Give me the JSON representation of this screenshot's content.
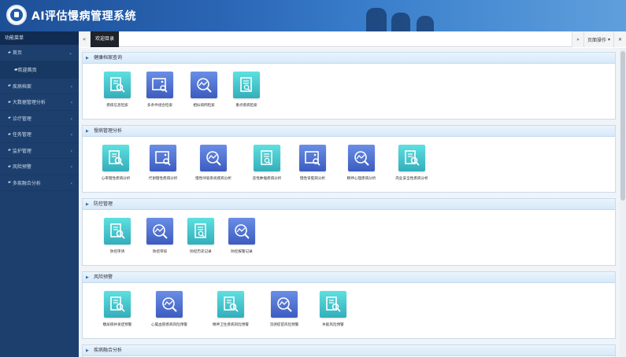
{
  "header": {
    "title": "AI评估慢病管理系统"
  },
  "sidebar": {
    "title": "功能菜单",
    "items": [
      {
        "label": "首页",
        "caret": "⌄"
      },
      {
        "label": "欢迎首页",
        "sub": true
      },
      {
        "label": "疾病档案",
        "caret": "‹"
      },
      {
        "label": "大数据管理分析",
        "caret": "‹"
      },
      {
        "label": "诊疗管理",
        "caret": "‹"
      },
      {
        "label": "任务管理",
        "caret": "‹"
      },
      {
        "label": "监护管理",
        "caret": "‹"
      },
      {
        "label": "风险预警",
        "caret": "‹"
      },
      {
        "label": "多疾融合分析",
        "caret": "‹"
      }
    ]
  },
  "tabbar": {
    "active_tab": "欢迎目录",
    "page_ops": "页面操作",
    "left_arrow": "«",
    "right_arrow": "»",
    "close": "✕"
  },
  "panels": [
    {
      "title": "健康档案查询",
      "tiles": [
        {
          "label": "疾病信息检索",
          "style": "teal",
          "icon": "document-search-icon"
        },
        {
          "label": "多条件组合检索",
          "style": "blue",
          "icon": "image-search-icon"
        },
        {
          "label": "相似病例检索",
          "style": "blue",
          "icon": "chart-search-icon"
        },
        {
          "label": "重点疾病检索",
          "style": "teal",
          "icon": "list-search-icon"
        }
      ]
    },
    {
      "title": "慢病管理分析",
      "tiles": [
        {
          "label": "心率慢性疾病分析",
          "style": "teal",
          "icon": "document-search-icon"
        },
        {
          "label": "代谢慢性疾病分析",
          "style": "blue",
          "icon": "image-search-icon"
        },
        {
          "label": "慢性呼吸系统疾病分析",
          "style": "blue",
          "icon": "chart-search-icon"
        },
        {
          "label": "恶性肿瘤疾病分析",
          "style": "teal",
          "icon": "list-search-icon"
        },
        {
          "label": "慢性肾脏病分析",
          "style": "blue",
          "icon": "image-search-icon"
        },
        {
          "label": "精神心理疾病分析",
          "style": "blue",
          "icon": "chart-search-icon"
        },
        {
          "label": "肉业安全性疾病分析",
          "style": "teal",
          "icon": "document-search-icon"
        }
      ]
    },
    {
      "title": "防控管理",
      "tiles": [
        {
          "label": "防控审请",
          "style": "teal",
          "icon": "document-search-icon"
        },
        {
          "label": "防控审核",
          "style": "blue",
          "icon": "chart-search-icon"
        },
        {
          "label": "防控历史记录",
          "style": "teal",
          "icon": "list-search-icon"
        },
        {
          "label": "防控报警记录",
          "style": "blue",
          "icon": "chart-search-icon"
        }
      ]
    },
    {
      "title": "风险预警",
      "tiles": [
        {
          "label": "糖尿病并发症预警",
          "style": "teal",
          "icon": "document-search-icon"
        },
        {
          "label": "心脑血管疾病风险预警",
          "style": "blue",
          "icon": "chart-search-icon"
        },
        {
          "label": "精神卫生疾病风险预警",
          "style": "teal",
          "icon": "document-search-icon"
        },
        {
          "label": "流感疫苗风险预警",
          "style": "blue",
          "icon": "chart-search-icon"
        },
        {
          "label": "失能风险预警",
          "style": "teal",
          "icon": "document-search-icon"
        }
      ]
    },
    {
      "title": "疾病融合分析",
      "tiles": []
    }
  ]
}
